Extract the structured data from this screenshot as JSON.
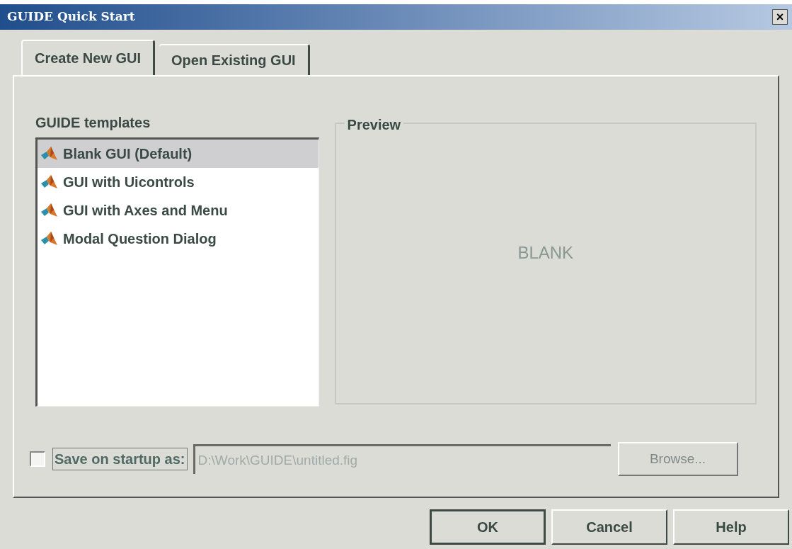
{
  "window": {
    "title": "GUIDE Quick Start",
    "close": "×"
  },
  "tabs": [
    {
      "label": "Create New GUI",
      "selected": true
    },
    {
      "label": "Open Existing GUI",
      "selected": false
    }
  ],
  "templates": {
    "label": "GUIDE templates",
    "items": [
      {
        "label": "Blank GUI (Default)",
        "selected": true
      },
      {
        "label": "GUI with Uicontrols",
        "selected": false
      },
      {
        "label": "GUI with Axes and Menu",
        "selected": false
      },
      {
        "label": "Modal Question Dialog",
        "selected": false
      }
    ]
  },
  "preview": {
    "label": "Preview",
    "text": "BLANK"
  },
  "save": {
    "label": "Save on startup as:",
    "checked": false,
    "value": "D:\\Work\\GUIDE\\untitled.fig",
    "disabled": true,
    "browse": "Browse..."
  },
  "buttons": [
    {
      "label": "OK",
      "default": true
    },
    {
      "label": "Cancel",
      "default": false
    },
    {
      "label": "Help",
      "default": false
    }
  ]
}
